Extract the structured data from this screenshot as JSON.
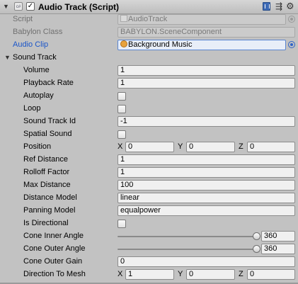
{
  "header": {
    "title": "Audio Track (Script)",
    "enabled": true,
    "script_icon_text": "c#"
  },
  "script_row": {
    "label": "Script",
    "value": "AudioTrack"
  },
  "babylon_class_row": {
    "label": "Babylon Class",
    "value": "BABYLON.SceneComponent"
  },
  "audio_clip_row": {
    "label": "Audio Clip",
    "value": "Background Music"
  },
  "sound_track": {
    "label": "Sound Track",
    "expanded": true,
    "fields": {
      "volume": {
        "label": "Volume",
        "value": "1"
      },
      "playback_rate": {
        "label": "Playback Rate",
        "value": "1"
      },
      "autoplay": {
        "label": "Autoplay",
        "checked": false
      },
      "loop": {
        "label": "Loop",
        "checked": false
      },
      "sound_track_id": {
        "label": "Sound Track Id",
        "value": "-1"
      },
      "spatial_sound": {
        "label": "Spatial Sound",
        "checked": false
      },
      "position": {
        "label": "Position",
        "x_label": "X",
        "x": "0",
        "y_label": "Y",
        "y": "0",
        "z_label": "Z",
        "z": "0"
      },
      "ref_distance": {
        "label": "Ref Distance",
        "value": "1"
      },
      "rolloff_factor": {
        "label": "Rolloff Factor",
        "value": "1"
      },
      "max_distance": {
        "label": "Max Distance",
        "value": "100"
      },
      "distance_model": {
        "label": "Distance Model",
        "value": "linear"
      },
      "panning_model": {
        "label": "Panning Model",
        "value": "equalpower"
      },
      "is_directional": {
        "label": "Is Directional",
        "checked": false
      },
      "cone_inner_angle": {
        "label": "Cone Inner Angle",
        "value": "360",
        "slider_fraction": 1.0
      },
      "cone_outer_angle": {
        "label": "Cone Outer Angle",
        "value": "360",
        "slider_fraction": 1.0
      },
      "cone_outer_gain": {
        "label": "Cone Outer Gain",
        "value": "0"
      },
      "direction_to_mesh": {
        "label": "Direction To Mesh",
        "x_label": "X",
        "x": "1",
        "y_label": "Y",
        "y": "0",
        "z_label": "Z",
        "z": "0"
      }
    }
  },
  "colors": {
    "panel_bg": "#c2c2c2",
    "field_bg": "#f0f0f0",
    "accent_label": "#1b56c9",
    "disabled_text": "#707070"
  }
}
